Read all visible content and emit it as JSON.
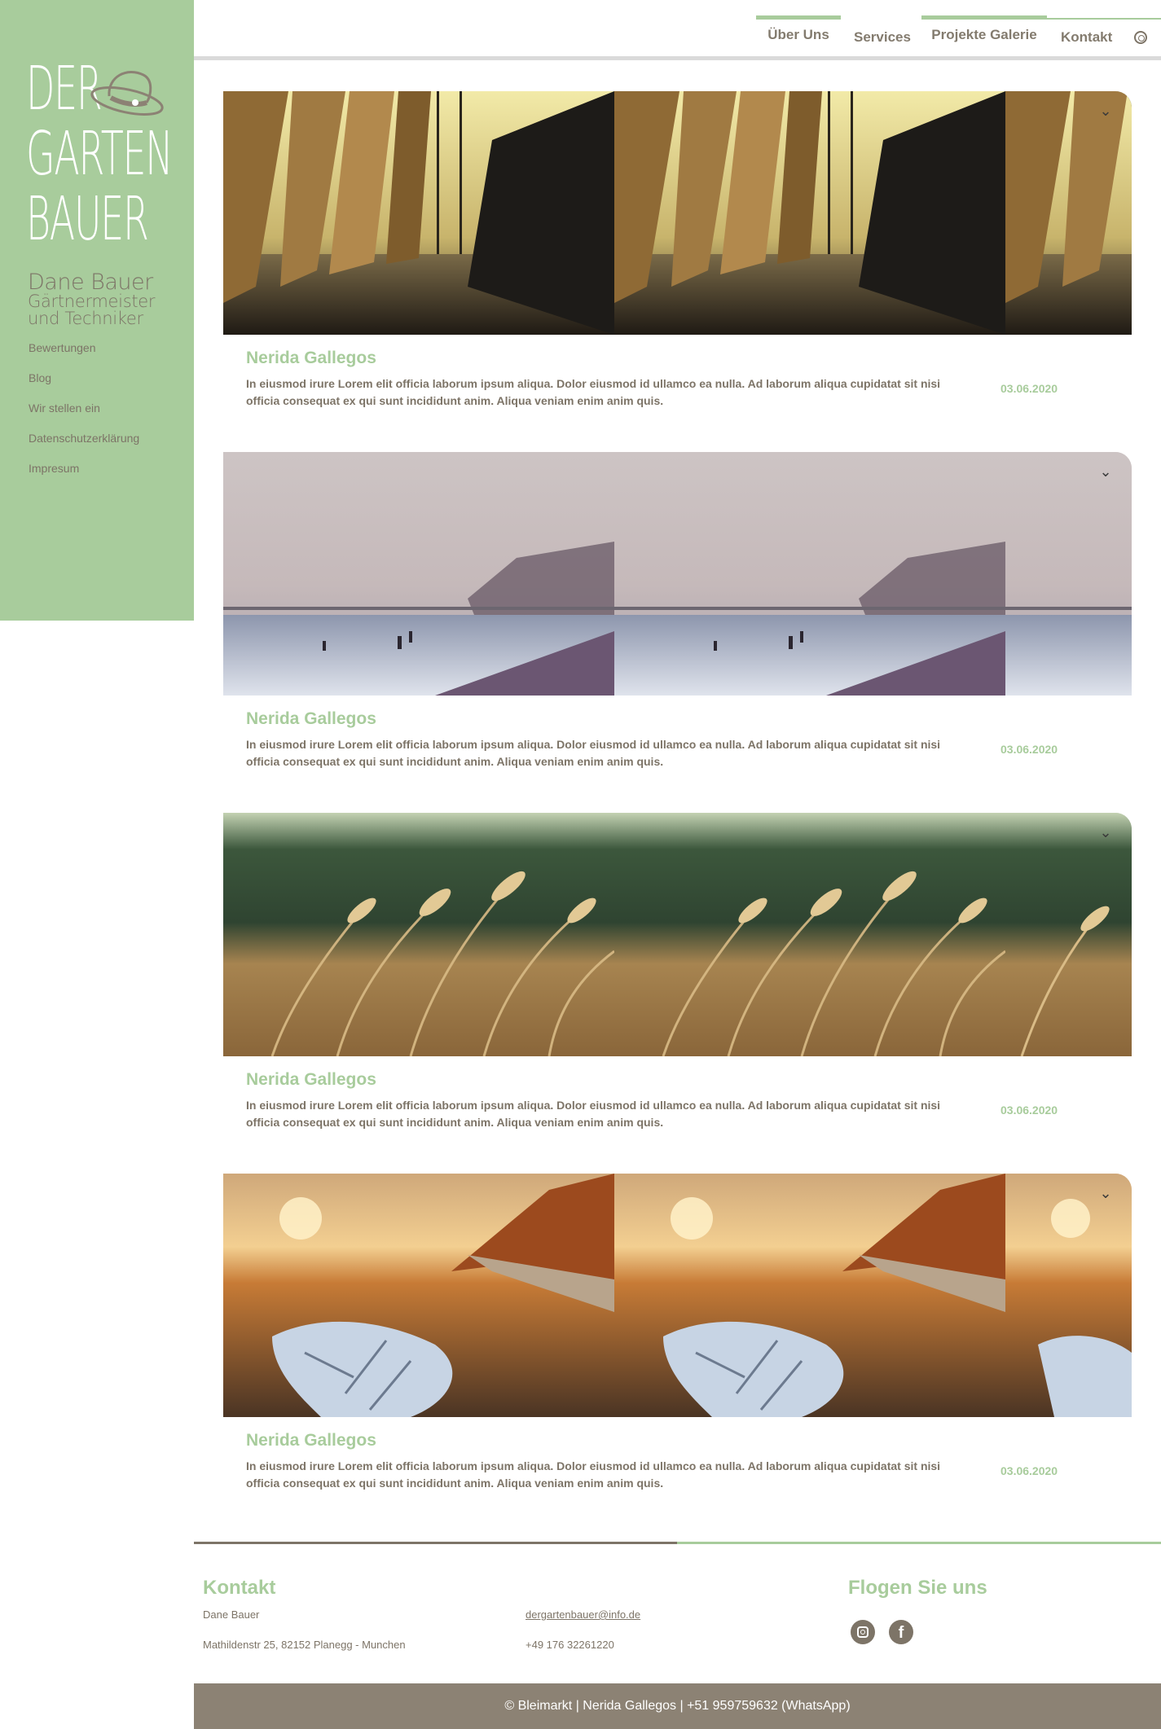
{
  "sidebar": {
    "logo_words": [
      "DER",
      "GARTEN",
      "BAUER"
    ],
    "owner_name": "Dane Bauer",
    "owner_title_1": "Gärtnermeister",
    "owner_title_2": "und Techniker",
    "items": [
      {
        "label": "Bewertungen"
      },
      {
        "label": "Blog"
      },
      {
        "label": "Wir stellen ein"
      },
      {
        "label": "Datenschutzerklärung"
      },
      {
        "label": "Impresum"
      }
    ]
  },
  "nav": {
    "items": [
      {
        "label": "Über Uns"
      },
      {
        "label": "Services"
      },
      {
        "label": "Projekte Galerie"
      },
      {
        "label": "Kontakt"
      }
    ]
  },
  "posts": [
    {
      "title": "Nerida Gallegos",
      "text": "In eiusmod irure Lorem elit officia laborum ipsum aliqua. Dolor eiusmod id ullamco ea nulla. Ad laborum aliqua cupidatat sit nisi officia consequat ex qui sunt incididunt anim. Aliqua veniam enim anim quis.",
      "date": "03.06.2020"
    },
    {
      "title": "Nerida Gallegos",
      "text": "In eiusmod irure Lorem elit officia laborum ipsum aliqua. Dolor eiusmod id ullamco ea nulla. Ad laborum aliqua cupidatat sit nisi officia consequat ex qui sunt incididunt anim. Aliqua veniam enim anim quis.",
      "date": "03.06.2020"
    },
    {
      "title": "Nerida Gallegos",
      "text": "In eiusmod irure Lorem elit officia laborum ipsum aliqua. Dolor eiusmod id ullamco ea nulla. Ad laborum aliqua cupidatat sit nisi officia consequat ex qui sunt incididunt anim. Aliqua veniam enim anim quis.",
      "date": "03.06.2020"
    },
    {
      "title": "Nerida Gallegos",
      "text": "In eiusmod irure Lorem elit officia laborum ipsum aliqua. Dolor eiusmod id ullamco ea nulla. Ad laborum aliqua cupidatat sit nisi officia consequat ex qui sunt incididunt anim. Aliqua veniam enim anim quis.",
      "date": "03.06.2020"
    }
  ],
  "footer": {
    "contact_title": "Kontakt",
    "name": "Dane Bauer",
    "address": "Mathildenstr 25, 82152 Planegg - Munchen",
    "email": "dergartenbauer@info.de",
    "phone": "+49 176 32261220",
    "follow_title": "Flogen Sie uns",
    "copyright": "© Bleimarkt | Nerida Gallegos | +51 959759632 (WhatsApp)"
  },
  "colors": {
    "accent_green": "#a8cc9c",
    "text_taupe": "#7d7467",
    "footer_bar": "#8c8274"
  },
  "icons": [
    "hat-logo-icon",
    "instagram-icon",
    "facebook-icon",
    "chevron-down-icon"
  ]
}
